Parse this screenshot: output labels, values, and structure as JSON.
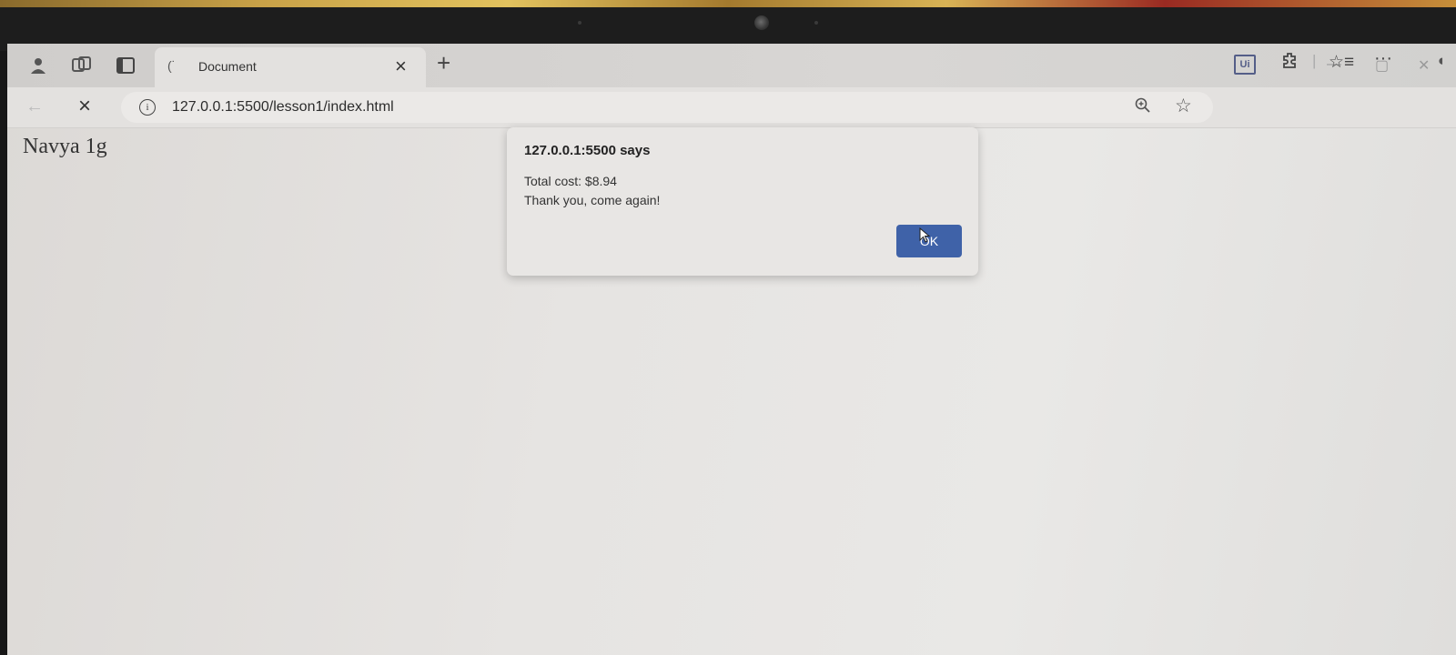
{
  "browser": {
    "tab": {
      "title": "Document",
      "favicon": "loading-spinner-icon"
    },
    "toolbar_icons": [
      "profile-icon",
      "workspaces-icon",
      "tab-actions-icon"
    ],
    "address_bar": {
      "url": "127.0.0.1:5500/lesson1/index.html"
    }
  },
  "page": {
    "text": "Navya 1g"
  },
  "alert_dialog": {
    "title": "127.0.0.1:5500 says",
    "message_line1": "Total cost: $8.94",
    "message_line2": "Thank you, come again!",
    "ok_label": "OK"
  },
  "colors": {
    "ok_button": "#3f62a8",
    "dialog_bg": "#e8e6e4"
  }
}
